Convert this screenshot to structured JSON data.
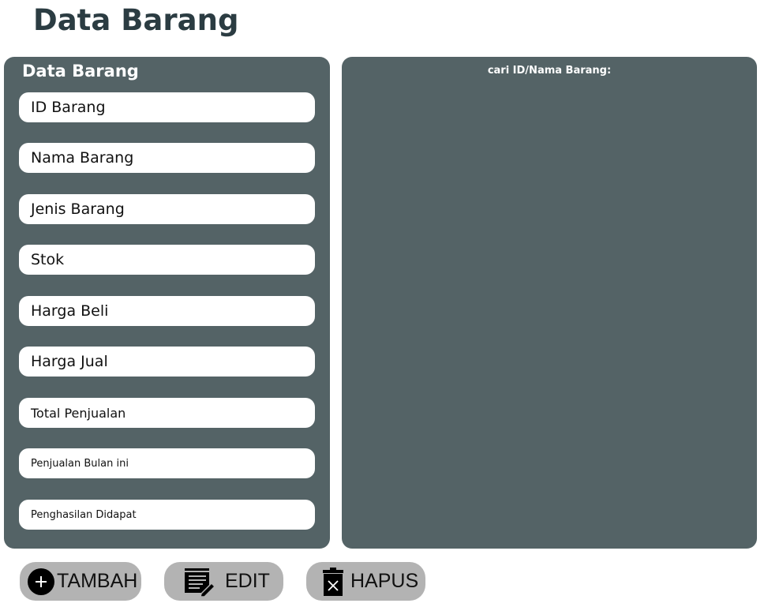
{
  "page": {
    "title": "Data Barang"
  },
  "form": {
    "title": "Data Barang",
    "fields": [
      {
        "label": "ID Barang"
      },
      {
        "label": "Nama Barang"
      },
      {
        "label": "Jenis Barang"
      },
      {
        "label": "Stok"
      },
      {
        "label": "Harga Beli"
      },
      {
        "label": "Harga Jual"
      },
      {
        "label": "Total Penjualan"
      },
      {
        "label": "Penjualan Bulan ini"
      },
      {
        "label": "Penghasilan Didapat"
      }
    ]
  },
  "search": {
    "label": "cari ID/Nama Barang:"
  },
  "buttons": {
    "tambah": {
      "label": "TAMBAH",
      "icon": "plus-circle-icon"
    },
    "edit": {
      "label": "EDIT",
      "icon": "edit-list-icon"
    },
    "hapus": {
      "label": "HAPUS",
      "icon": "trash-icon"
    }
  },
  "colors": {
    "panel": "#546366",
    "title": "#2b3c42",
    "button": "#b3b3b3"
  }
}
